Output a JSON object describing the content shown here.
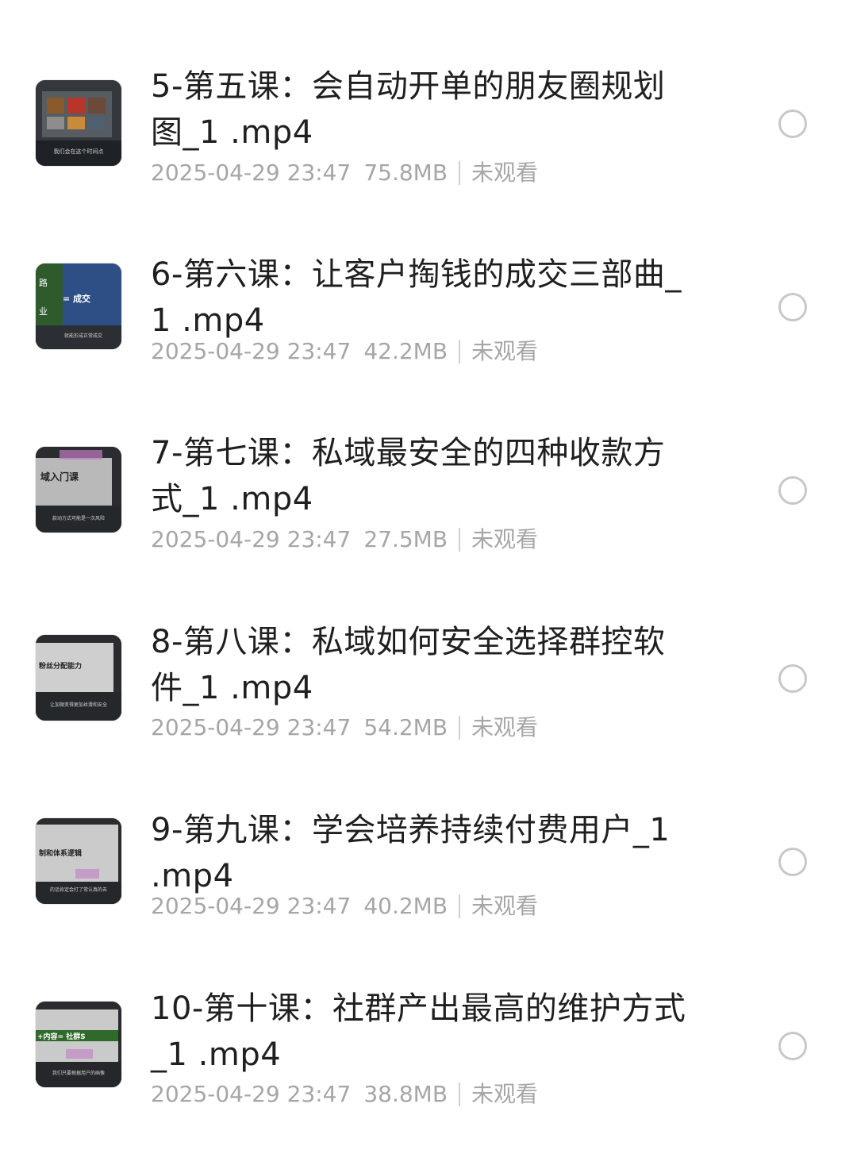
{
  "files": [
    {
      "title": "5-第五课：会自动开单的朋友圈规划图_1 .mp4",
      "date": "2025-04-29 23:47",
      "size": "75.8MB",
      "status": "未观看",
      "thumb_text": [
        "我们会在这个时间点"
      ]
    },
    {
      "title": "6-第六课：让客户掏钱的成交三部曲_1 .mp4",
      "date": "2025-04-29 23:47",
      "size": "42.2MB",
      "status": "未观看",
      "thumb_text": [
        "路",
        "= 成交",
        "业",
        "就能形成正常成交"
      ]
    },
    {
      "title": "7-第七课：私域最安全的四种收款方式_1 .mp4",
      "date": "2025-04-29 23:47",
      "size": "27.5MB",
      "status": "未观看",
      "thumb_text": [
        "域入门课",
        "款动方式可能是一次风险"
      ]
    },
    {
      "title": "8-第八课：私域如何安全选择群控软件_1 .mp4",
      "date": "2025-04-29 23:47",
      "size": "54.2MB",
      "status": "未观看",
      "thumb_text": [
        "粉丝分配能力",
        "让加微变得更加丝滑和安全"
      ]
    },
    {
      "title": "9-第九课：学会培养持续付费用户_1 .mp4",
      "date": "2025-04-29 23:47",
      "size": "40.2MB",
      "status": "未观看",
      "thumb_text": [
        "制和体系逻辑",
        "的话肯定会打了常认真的去"
      ]
    },
    {
      "title": "10-第十课：社群产出最高的维护方式_1 .mp4",
      "date": "2025-04-29 23:47",
      "size": "38.8MB",
      "status": "未观看",
      "thumb_text": [
        "+内容= 社群S",
        "我们只要根据用户的画像"
      ]
    }
  ],
  "colors": {
    "title": "#1f1f1f",
    "meta": "#a6a6a6",
    "radio_border": "#c8c8c8"
  },
  "icons": {
    "thumbnail": "video-thumbnail",
    "select": "radio-unchecked-icon"
  }
}
